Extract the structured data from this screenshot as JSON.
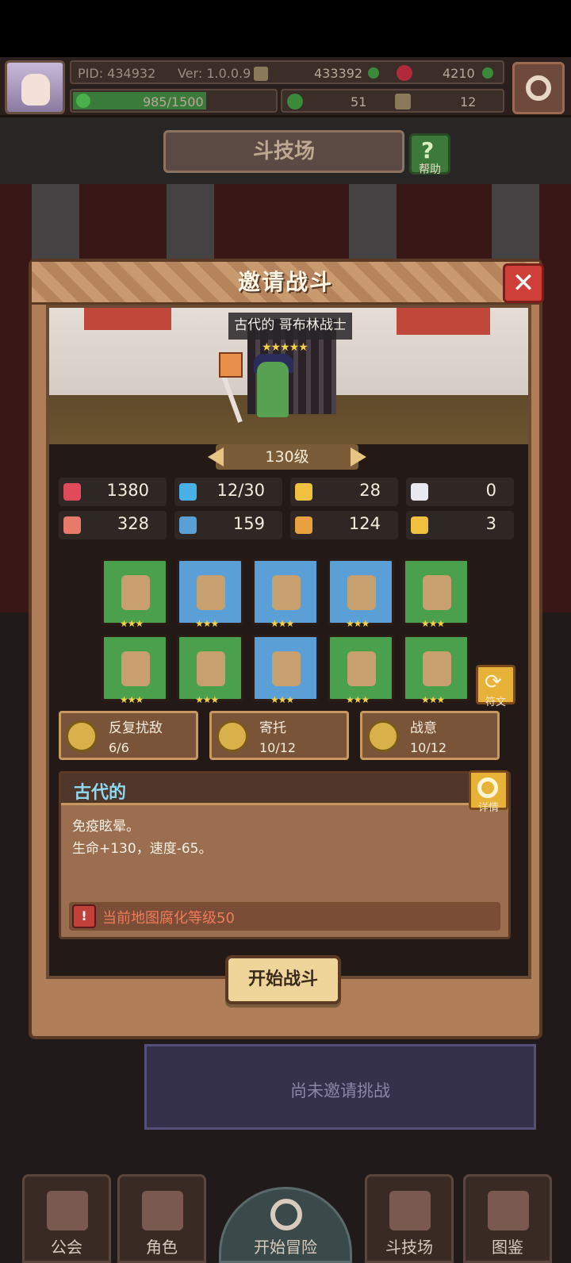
{
  "hud": {
    "pid": "PID: 434932",
    "version": "Ver: 1.0.0.9",
    "currency1": "433392",
    "currency2": "4210",
    "xp_text": "985/1500",
    "xp_progress": 0.657,
    "currency3": "51",
    "currency4": "12"
  },
  "header": {
    "title": "斗技场",
    "help_label": "帮助"
  },
  "dialog": {
    "title": "邀请战斗",
    "close": "✕",
    "enemy_name": "古代的 哥布林战士",
    "enemy_stars": "★★★★★",
    "level": "130级",
    "stats": [
      {
        "icon": "heart-icon",
        "value": "1380",
        "color": "#e04a5a"
      },
      {
        "icon": "water-drop-icon",
        "value": "12/30",
        "color": "#4ab0e8"
      },
      {
        "icon": "shield-icon",
        "value": "28",
        "color": "#f0c040"
      },
      {
        "icon": "wing-icon",
        "value": "0",
        "color": "#e8e8f0"
      },
      {
        "icon": "fist-icon",
        "value": "328",
        "color": "#e87a6a"
      },
      {
        "icon": "book-icon",
        "value": "159",
        "color": "#5a9fd6"
      },
      {
        "icon": "boot-icon",
        "value": "124",
        "color": "#e8a040"
      },
      {
        "icon": "horseshoe-icon",
        "value": "3",
        "color": "#f0c040"
      }
    ],
    "equipment_row1": [
      {
        "name": "spear-icon",
        "rarity": "green",
        "stars": "★★★"
      },
      {
        "name": "shield-item-icon",
        "rarity": "blue",
        "stars": "★★★"
      },
      {
        "name": "necklace-icon",
        "rarity": "blue",
        "stars": "★★★"
      },
      {
        "name": "medallion-icon",
        "rarity": "blue",
        "stars": "★★★"
      },
      {
        "name": "ring-icon",
        "rarity": "green",
        "stars": "★★★"
      }
    ],
    "equipment_row2": [
      {
        "name": "pauldron-icon",
        "rarity": "green",
        "stars": "★★★"
      },
      {
        "name": "tunic-icon",
        "rarity": "green",
        "stars": "★★★"
      },
      {
        "name": "bracer-icon",
        "rarity": "blue",
        "stars": "★★★"
      },
      {
        "name": "belt-icon",
        "rarity": "green",
        "stars": "★★★"
      },
      {
        "name": "boots-icon",
        "rarity": "green",
        "stars": "★★★"
      }
    ],
    "rune_label": "符文",
    "skills": [
      {
        "name": "反复扰敌",
        "count": "6/6"
      },
      {
        "name": "寄托",
        "count": "10/12"
      },
      {
        "name": "战意",
        "count": "10/12"
      }
    ],
    "desc_title": "古代的",
    "detail_label": "详情",
    "desc_line1": "免疫眩晕。",
    "desc_line2": "生命+130，速度-65。",
    "warning": "当前地图腐化等级50",
    "start_button": "开始战斗"
  },
  "no_invite": "尚未邀请挑战",
  "nav": [
    "公会",
    "角色",
    "开始冒险",
    "斗技场",
    "图鉴"
  ]
}
